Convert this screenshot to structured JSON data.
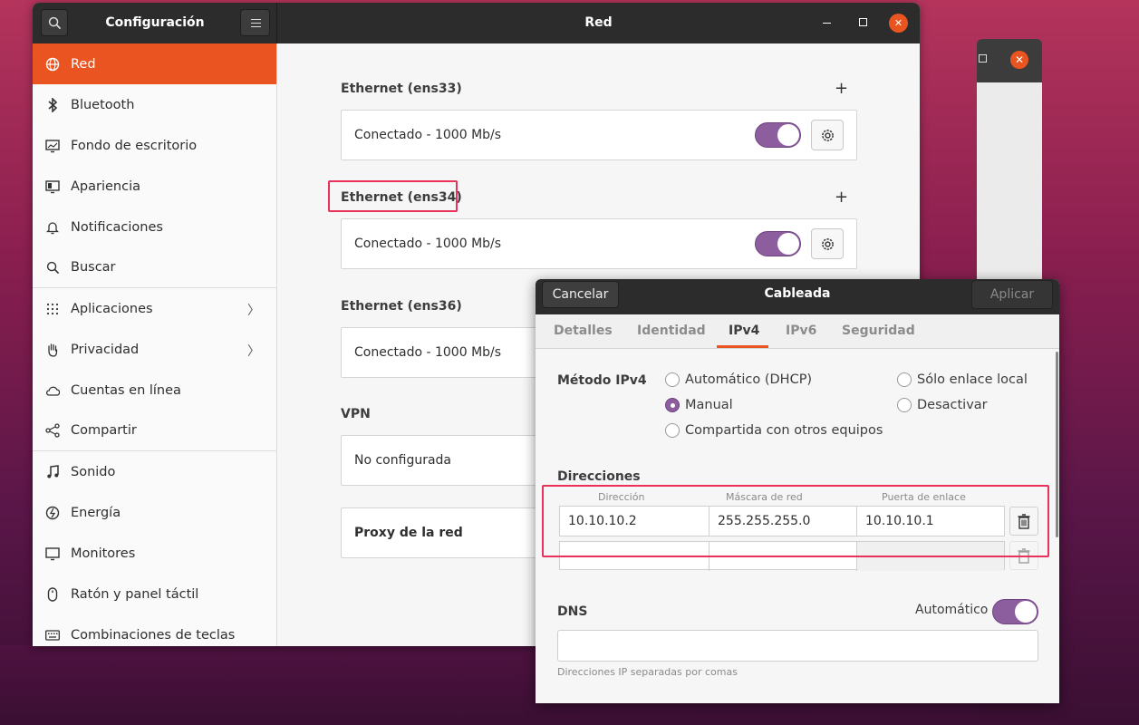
{
  "main_window": {
    "sidebar_title": "Configuración",
    "title": "Red"
  },
  "sidebar": {
    "items": [
      {
        "label": "Red",
        "icon": "network-icon",
        "active": true
      },
      {
        "label": "Bluetooth",
        "icon": "bluetooth-icon"
      },
      {
        "label": "Fondo de escritorio",
        "icon": "wallpaper-icon"
      },
      {
        "label": "Apariencia",
        "icon": "appearance-icon"
      },
      {
        "label": "Notificaciones",
        "icon": "bell-icon"
      },
      {
        "label": "Buscar",
        "icon": "search-icon"
      },
      {
        "label": "Aplicaciones",
        "icon": "apps-grid-icon"
      },
      {
        "label": "Privacidad",
        "icon": "hand-icon"
      },
      {
        "label": "Cuentas en línea",
        "icon": "cloud-icon"
      },
      {
        "label": "Compartir",
        "icon": "share-icon"
      },
      {
        "label": "Sonido",
        "icon": "music-note-icon"
      },
      {
        "label": "Energía",
        "icon": "power-icon"
      },
      {
        "label": "Monitores",
        "icon": "monitor-icon"
      },
      {
        "label": "Ratón y panel táctil",
        "icon": "mouse-icon"
      },
      {
        "label": "Combinaciones de teclas",
        "icon": "keyboard-icon"
      }
    ]
  },
  "network": {
    "sections": [
      {
        "title": "Ethernet (ens33)",
        "status": "Conectado - 1000 Mb/s",
        "enabled": true
      },
      {
        "title": "Ethernet (ens34)",
        "status": "Conectado - 1000 Mb/s",
        "enabled": true
      },
      {
        "title": "Ethernet (ens36)",
        "status": "Conectado - 1000 Mb/s"
      }
    ],
    "vpn": {
      "title": "VPN",
      "status": "No configurada"
    },
    "proxy": {
      "label": "Proxy de la red"
    }
  },
  "dialog": {
    "title": "Cableada",
    "cancel_label": "Cancelar",
    "apply_label": "Aplicar",
    "tabs": [
      "Detalles",
      "Identidad",
      "IPv4",
      "IPv6",
      "Seguridad"
    ],
    "active_tab": "IPv4",
    "method_label": "Método IPv4",
    "methods": {
      "auto": "Automático (DHCP)",
      "link_local": "Sólo enlace local",
      "manual": "Manual",
      "disable": "Desactivar",
      "shared": "Compartida con otros equipos"
    },
    "selected_method": "Manual",
    "addresses_label": "Direcciones",
    "columns": [
      "Dirección",
      "Máscara de red",
      "Puerta de enlace"
    ],
    "addresses": [
      {
        "address": "10.10.10.2",
        "netmask": "255.255.255.0",
        "gateway": "10.10.10.1"
      }
    ],
    "dns_label": "DNS",
    "dns_auto_label": "Automático",
    "dns_auto": true,
    "dns_value": "",
    "dns_hint": "Direcciones IP separadas por comas"
  },
  "colors": {
    "accent": "#e95420",
    "toggle": "#8c5e9e",
    "highlight": "#e8315b",
    "headerbar": "#2c2c2c"
  }
}
